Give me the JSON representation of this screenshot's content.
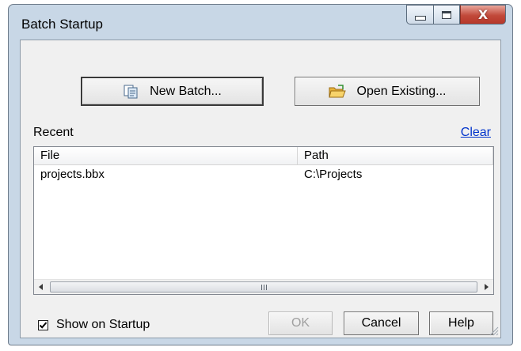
{
  "window": {
    "title": "Batch Startup"
  },
  "caption": {
    "minimize_icon": "minimize-icon",
    "maximize_icon": "maximize-icon",
    "close_glyph": "X"
  },
  "toolbar": {
    "new_batch_label": "New Batch...",
    "open_existing_label": "Open Existing..."
  },
  "recent": {
    "label": "Recent",
    "clear_link": "Clear",
    "columns": [
      "File",
      "Path"
    ],
    "rows": [
      {
        "file": "projects.bbx",
        "path": "C:\\Projects"
      }
    ]
  },
  "scrollbar": {
    "grip_glyph": "III"
  },
  "footer": {
    "show_on_startup_label": "Show on Startup",
    "show_on_startup_checked": true,
    "ok_label": "OK",
    "cancel_label": "Cancel",
    "help_label": "Help"
  },
  "colors": {
    "link": "#0033cc",
    "frame": "#c8d7e6",
    "close_button": "#c1493a"
  }
}
